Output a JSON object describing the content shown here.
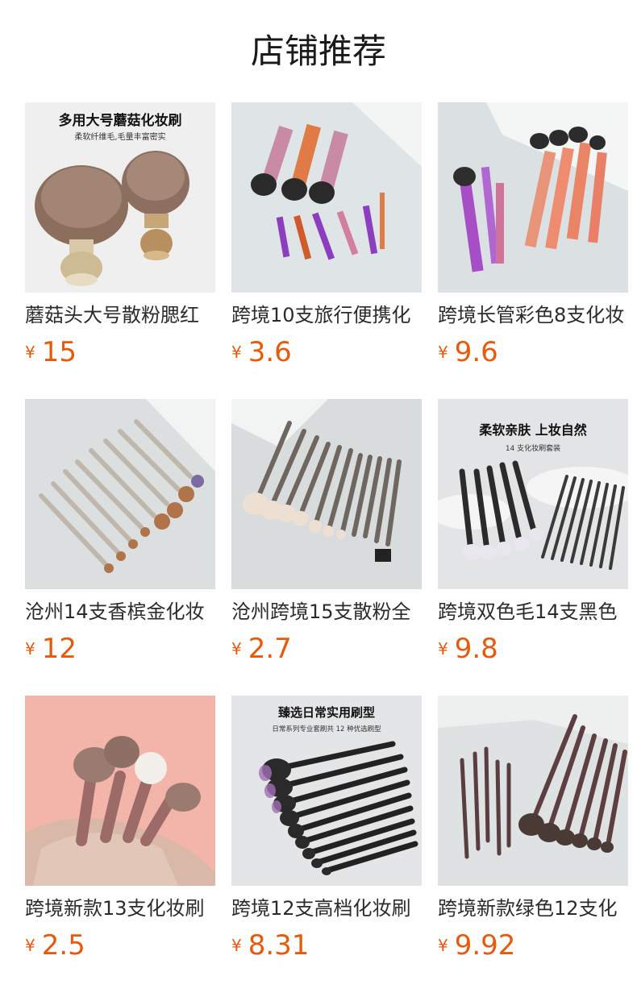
{
  "page": {
    "title": "店铺推荐",
    "currency_symbol": "¥"
  },
  "colors": {
    "price": "#e8590c",
    "text": "#2b2b2b"
  },
  "products": [
    {
      "name": "蘑菇头大号散粉腮红",
      "price": "15",
      "image_caption": "多用大号蘑菇化妆刷",
      "image_subcaption": "柔软纤维毛,毛量丰富密实"
    },
    {
      "name": "跨境10支旅行便携化",
      "price": "3.6"
    },
    {
      "name": "跨境长管彩色8支化妆",
      "price": "9.6"
    },
    {
      "name": "沧州14支香槟金化妆",
      "price": "12"
    },
    {
      "name": "沧州跨境15支散粉全",
      "price": "2.7"
    },
    {
      "name": "跨境双色毛14支黑色",
      "price": "9.8",
      "image_caption": "柔软亲肤 上妆自然",
      "image_subcaption": "14 支化妆刷套装"
    },
    {
      "name": "跨境新款13支化妆刷",
      "price": "2.5"
    },
    {
      "name": "跨境12支高档化妆刷",
      "price": "8.31",
      "image_caption": "臻选日常实用刷型",
      "image_subcaption": "日常系列专业套刷共 12 种优选刷型"
    },
    {
      "name": "跨境新款绿色12支化",
      "price": "9.92"
    }
  ]
}
